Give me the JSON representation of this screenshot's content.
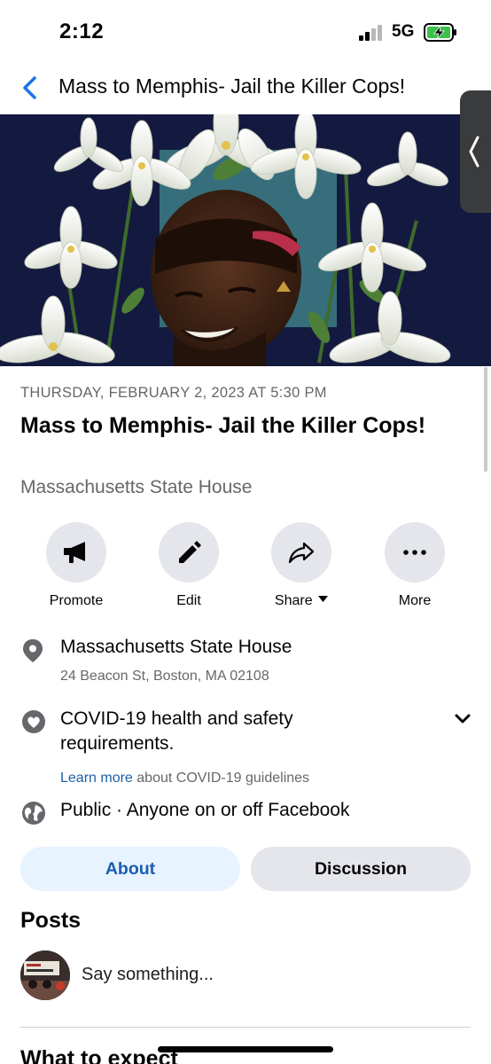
{
  "status_bar": {
    "time": "2:12",
    "network": "5G"
  },
  "header": {
    "title": "Mass to Memphis- Jail the Killer Cops!"
  },
  "event": {
    "date": "THURSDAY, FEBRUARY 2, 2023 AT 5:30 PM",
    "title": "Mass to Memphis- Jail the Killer Cops!",
    "venue": "Massachusetts State House"
  },
  "actions": [
    {
      "label": "Promote",
      "icon": "megaphone-icon"
    },
    {
      "label": "Edit",
      "icon": "pencil-icon"
    },
    {
      "label": "Share",
      "icon": "share-icon"
    },
    {
      "label": "More",
      "icon": "more-icon"
    }
  ],
  "details": {
    "location_name": "Massachusetts State House",
    "location_address": "24 Beacon St, Boston, MA 02108",
    "covid_title": "COVID-19 health and safety",
    "covid_title_2": "requirements.",
    "covid_link": "Learn more",
    "covid_link_rest": " about COVID-19 guidelines",
    "privacy": "Public · Anyone on or off Facebook"
  },
  "tabs": [
    {
      "label": "About"
    },
    {
      "label": "Discussion"
    }
  ],
  "posts": {
    "heading": "Posts",
    "composer_placeholder": "Say something..."
  },
  "next_section": {
    "heading": "What to expect"
  },
  "colors": {
    "accent": "#1b5eb0",
    "secondary_text": "#65676b",
    "button_bg": "#e4e6eb",
    "cover_bg": "#141a3f"
  }
}
